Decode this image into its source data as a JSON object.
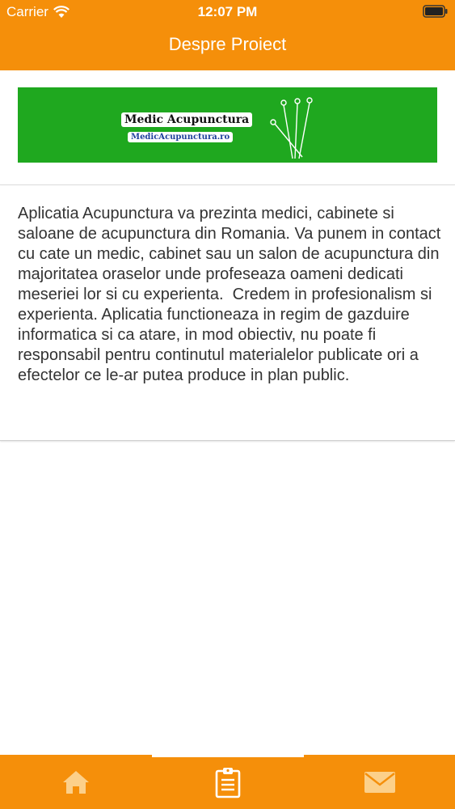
{
  "status_bar": {
    "carrier": "Carrier",
    "time": "12:07 PM",
    "wifi_icon": "wifi-icon",
    "battery_icon": "battery-icon"
  },
  "nav": {
    "title": "Despre Proiect"
  },
  "banner": {
    "background_color": "#1fa81f",
    "logo_title": "Medic Acupunctura",
    "logo_url": "MedicAcupunctura.ro",
    "graphic_icon": "acupuncture-needles-icon"
  },
  "description": {
    "text": "Aplicatia Acupunctura va prezinta medici, cabinete si saloane de acupunctura din Romania. Va punem in contact cu cate un medic, cabinet sau un salon de acupunctura din majoritatea oraselor unde profeseaza oameni dedicati meseriei lor si cu experienta.  Credem in profesionalism si experienta. Aplicatia functioneaza in regim de gazduire informatica si ca atare, in mod obiectiv, nu poate fi responsabil pentru continutul materialelor publicate ori a efectelor ce le-ar putea produce in plan public."
  },
  "tab_bar": {
    "accent_color": "#f58f0a",
    "inactive_icon_color": "#fcd08a",
    "active_icon_color": "#ffffff",
    "tabs": [
      {
        "icon": "home-icon",
        "active": false
      },
      {
        "icon": "clipboard-icon",
        "active": true
      },
      {
        "icon": "mail-icon",
        "active": false
      }
    ]
  }
}
